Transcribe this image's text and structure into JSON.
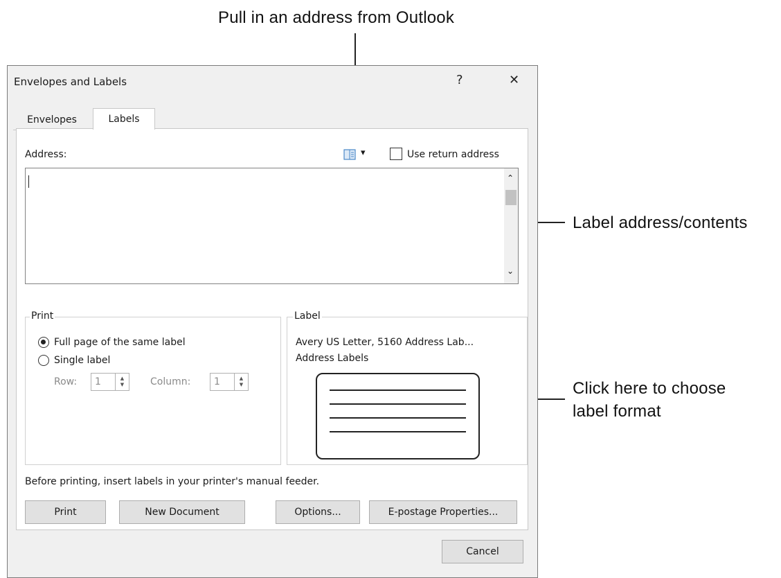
{
  "callouts": {
    "outlook": "Pull in an address from Outlook",
    "address": "Label address/contents",
    "format_line1": "Click here to choose",
    "format_line2": "label format"
  },
  "dialog": {
    "title": "Envelopes and Labels",
    "help_glyph": "?",
    "close_glyph": "✕",
    "tabs": [
      {
        "label": "Envelopes",
        "active": false
      },
      {
        "label": "Labels",
        "active": true
      }
    ],
    "address_label": "Address:",
    "address_value": "",
    "address_book_icon": "address-book-icon",
    "dropdown_glyph": "▾",
    "use_return_address": {
      "label": "Use return address",
      "checked": false
    },
    "scroll_up_glyph": "⌃",
    "scroll_down_glyph": "⌄",
    "print_group": {
      "legend": "Print",
      "full_page": {
        "label": "Full page of the same label",
        "checked": true
      },
      "single_label": {
        "label": "Single label",
        "checked": false
      },
      "row_label": "Row:",
      "row_value": "1",
      "column_label": "Column:",
      "column_value": "1"
    },
    "label_group": {
      "legend": "Label",
      "line1": "Avery US Letter, 5160 Address Lab...",
      "line2": "Address Labels"
    },
    "hint": "Before printing, insert labels in your printer's manual feeder.",
    "buttons": {
      "print": "Print",
      "new_document": "New Document",
      "options": "Options...",
      "epostage": "E-postage Properties...",
      "cancel": "Cancel"
    }
  }
}
